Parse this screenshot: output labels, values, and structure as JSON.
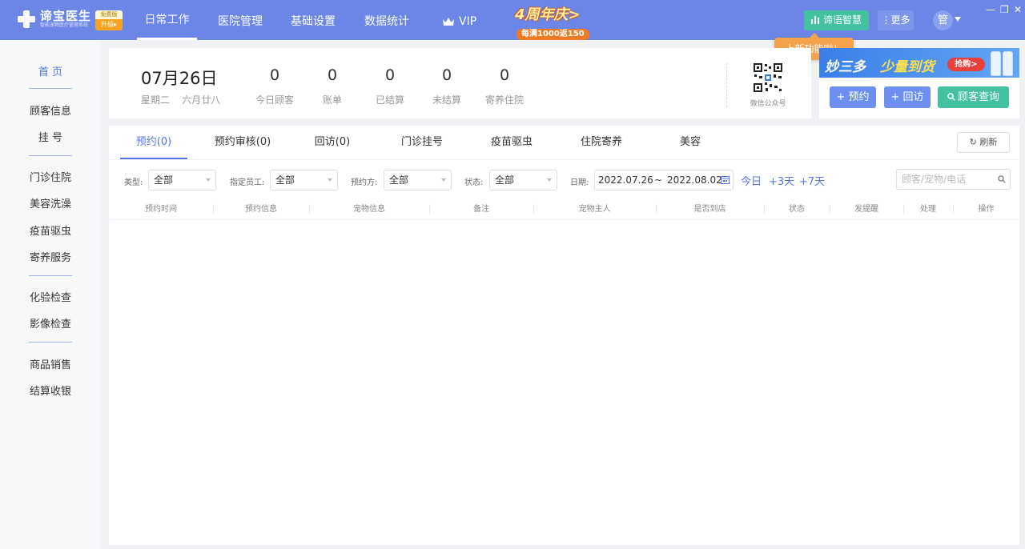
{
  "app": {
    "logo_name": "谛宝医生",
    "logo_sub": "智能宠物医疗管理系统",
    "edition_label": "免费版",
    "upgrade_label": "升级"
  },
  "topnav": {
    "items": [
      "日常工作",
      "医院管理",
      "基础设置",
      "数据统计",
      "VIP"
    ],
    "active": "日常工作",
    "anniversary_title": "4周年庆>",
    "anniversary_sub": "每满1000返150",
    "smart_label": "谛语智慧",
    "more_label": "更多",
    "avatar_text": "管",
    "window_controls": [
      "—",
      "❐",
      "✕"
    ],
    "tooltip": "上新功能啦！"
  },
  "sidebar": {
    "items": [
      "首 页",
      "顾客信息",
      "挂 号",
      "门诊住院",
      "美容洗澡",
      "疫苗驱虫",
      "寄养服务",
      "化验检查",
      "影像检查",
      "商品销售",
      "结算收银"
    ],
    "active": "首 页"
  },
  "stats": {
    "date": "07月26日",
    "weekday": "星期二",
    "lunar": "六月廿八",
    "items": [
      {
        "value": "0",
        "label": "今日顾客"
      },
      {
        "value": "0",
        "label": "账单"
      },
      {
        "value": "0",
        "label": "已结算"
      },
      {
        "value": "0",
        "label": "未结算"
      },
      {
        "value": "0",
        "label": "寄养住院"
      }
    ],
    "qr_label": "微信公众号"
  },
  "banner": {
    "text1": "妙三多",
    "text2": "少量到货",
    "buy": "抢购>"
  },
  "actions": {
    "appointment": "预约",
    "revisit": "回访",
    "customer_query": "顾客查询"
  },
  "tabs": {
    "items": [
      "预约(0)",
      "预约审核(0)",
      "回访(0)",
      "门诊挂号",
      "疫苗驱虫",
      "住院寄养",
      "美容"
    ],
    "active": "预约(0)",
    "refresh_label": "刷新"
  },
  "filters": {
    "type_label": "类型:",
    "type_value": "全部",
    "staff_label": "指定员工:",
    "staff_value": "全部",
    "party_label": "预约方:",
    "party_value": "全部",
    "status_label": "状态:",
    "status_value": "全部",
    "date_label": "日期:",
    "date_start": "2022.07.26",
    "date_sep": "~",
    "date_end": "2022.08.02",
    "quick": [
      "今日",
      "+3天",
      "+7天"
    ],
    "search_placeholder": "顾客/宠物/电话"
  },
  "table": {
    "columns": [
      "预约时间",
      "预约信息",
      "宠物信息",
      "备注",
      "宠物主人",
      "是否到店",
      "状态",
      "发提醒",
      "处理",
      "操作"
    ]
  },
  "colors": {
    "primary": "#6c86e8",
    "accent": "#5474e8",
    "teal": "#44c1a0",
    "orange": "#f4a24c"
  }
}
